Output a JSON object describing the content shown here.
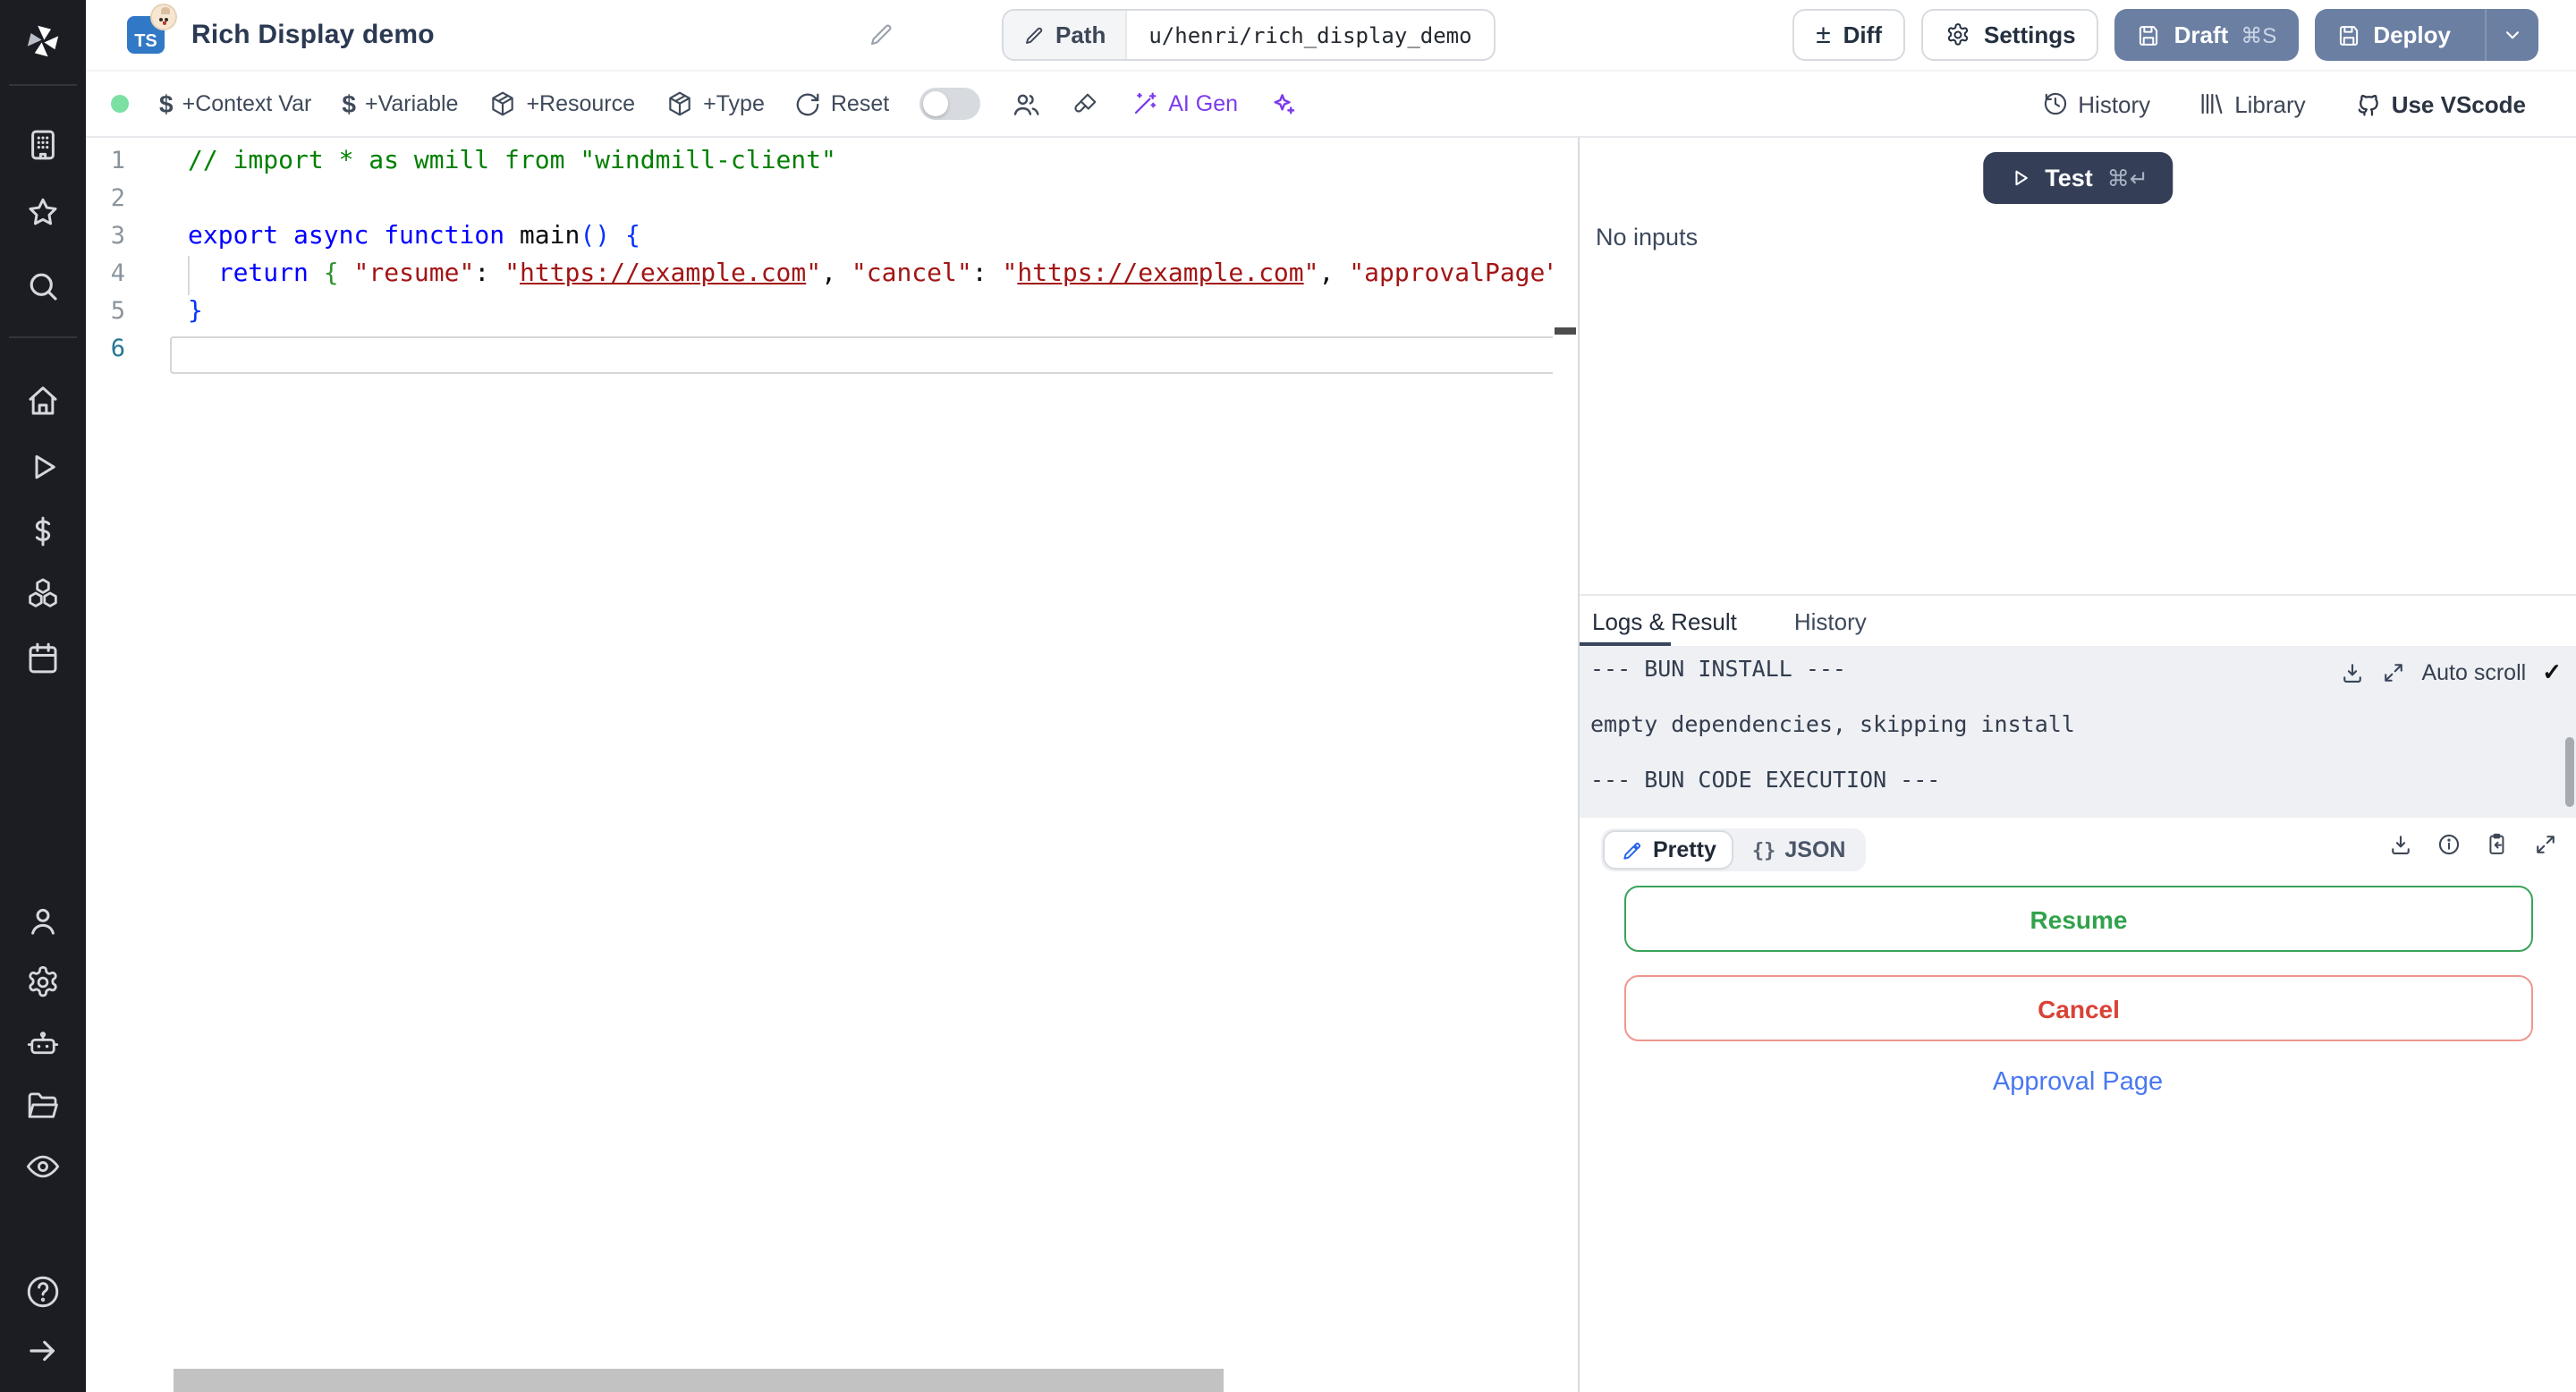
{
  "header": {
    "language_badge": "TS",
    "title": "Rich Display demo",
    "path_label": "Path",
    "path_value": "u/henri/rich_display_demo",
    "diff_label": "Diff",
    "settings_label": "Settings",
    "draft_label": "Draft",
    "draft_shortcut": "⌘S",
    "deploy_label": "Deploy"
  },
  "toolbar": {
    "context_var": "+Context Var",
    "variable": "+Variable",
    "resource": "+Resource",
    "type": "+Type",
    "reset": "Reset",
    "ai_gen": "AI Gen",
    "history": "History",
    "library": "Library",
    "vscode": "Use VScode"
  },
  "glyphs": {
    "dollar": "$",
    "plusminus": "±",
    "braces": "{}",
    "check": "✓"
  },
  "editor": {
    "lines": [
      {
        "num": "1",
        "tokens": [
          [
            "// import * as wmill from \"windmill-client\"",
            "comment"
          ]
        ]
      },
      {
        "num": "2",
        "tokens": []
      },
      {
        "num": "3",
        "tokens": [
          [
            "export ",
            "kw"
          ],
          [
            "async ",
            "kw"
          ],
          [
            "function ",
            "kw"
          ],
          [
            "main",
            "plain"
          ],
          [
            "()",
            "br1"
          ],
          [
            " ",
            "plain"
          ],
          [
            "{",
            "br1"
          ]
        ]
      },
      {
        "num": "4",
        "tokens": [
          [
            "  ",
            "plain"
          ],
          [
            "return",
            "kw"
          ],
          [
            " ",
            "plain"
          ],
          [
            "{",
            "br2"
          ],
          [
            " ",
            "plain"
          ],
          [
            "\"resume\"",
            "str"
          ],
          [
            ": ",
            "plain"
          ],
          [
            "\"",
            "str"
          ],
          [
            "https://example.com",
            "link"
          ],
          [
            "\"",
            "str"
          ],
          [
            ", ",
            "plain"
          ],
          [
            "\"cancel\"",
            "str"
          ],
          [
            ": ",
            "plain"
          ],
          [
            "\"",
            "str"
          ],
          [
            "https://example.com",
            "link"
          ],
          [
            "\"",
            "str"
          ],
          [
            ", ",
            "plain"
          ],
          [
            "\"approvalPage\"",
            "str"
          ],
          [
            ":",
            "plain"
          ]
        ]
      },
      {
        "num": "5",
        "tokens": [
          [
            "}",
            "br1"
          ]
        ]
      },
      {
        "num": "6",
        "tokens": [],
        "active": true
      }
    ]
  },
  "run": {
    "test_label": "Test",
    "test_shortcut": "⌘↵",
    "no_inputs": "No inputs"
  },
  "tabs": {
    "logs": "Logs & Result",
    "history": "History"
  },
  "logs": {
    "lines": [
      "--- BUN INSTALL ---",
      "empty dependencies, skipping install",
      "--- BUN CODE EXECUTION ---"
    ],
    "auto_scroll": "Auto scroll"
  },
  "result": {
    "pretty": "Pretty",
    "json": "JSON",
    "resume": "Resume",
    "cancel": "Cancel",
    "approval": "Approval Page"
  },
  "colors": {
    "accent_slate": "#6b7fa3",
    "test_navy": "#343f57",
    "resume_green": "#31a24c",
    "cancel_red": "#da4236",
    "approval_blue": "#4a78f2",
    "ai_purple": "#7c3aed",
    "status_dot_green": "#7ce0a3"
  }
}
